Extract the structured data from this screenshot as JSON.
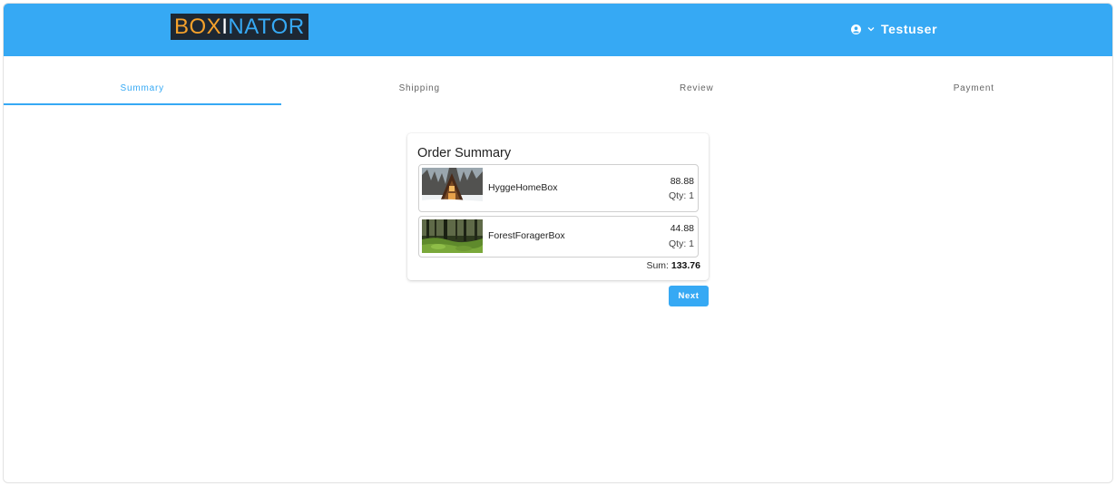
{
  "header": {
    "logo": {
      "part1": "BOX",
      "part2": "I",
      "part3": "NATOR"
    },
    "user": {
      "icon": "user-circle-icon",
      "dropdown_icon": "chevron-down-icon",
      "name": "Testuser"
    }
  },
  "tabs": [
    {
      "label": "Summary",
      "active": true
    },
    {
      "label": "Shipping",
      "active": false
    },
    {
      "label": "Review",
      "active": false
    },
    {
      "label": "Payment",
      "active": false
    }
  ],
  "order_summary": {
    "title": "Order Summary",
    "items": [
      {
        "name": "HyggeHomeBox",
        "price": "88.88",
        "qty": "Qty: 1",
        "image": "a-frame-cabin-in-snowy-forest"
      },
      {
        "name": "ForestForagerBox",
        "price": "44.88",
        "qty": "Qty: 1",
        "image": "mossy-forest-floor"
      }
    ],
    "sum_label": "Sum:",
    "sum_value": "133.76"
  },
  "actions": {
    "next_label": "Next"
  },
  "colors": {
    "primary": "#36a9f4",
    "logo_bg": "#1d2733",
    "logo_orange": "#f5a12b"
  }
}
